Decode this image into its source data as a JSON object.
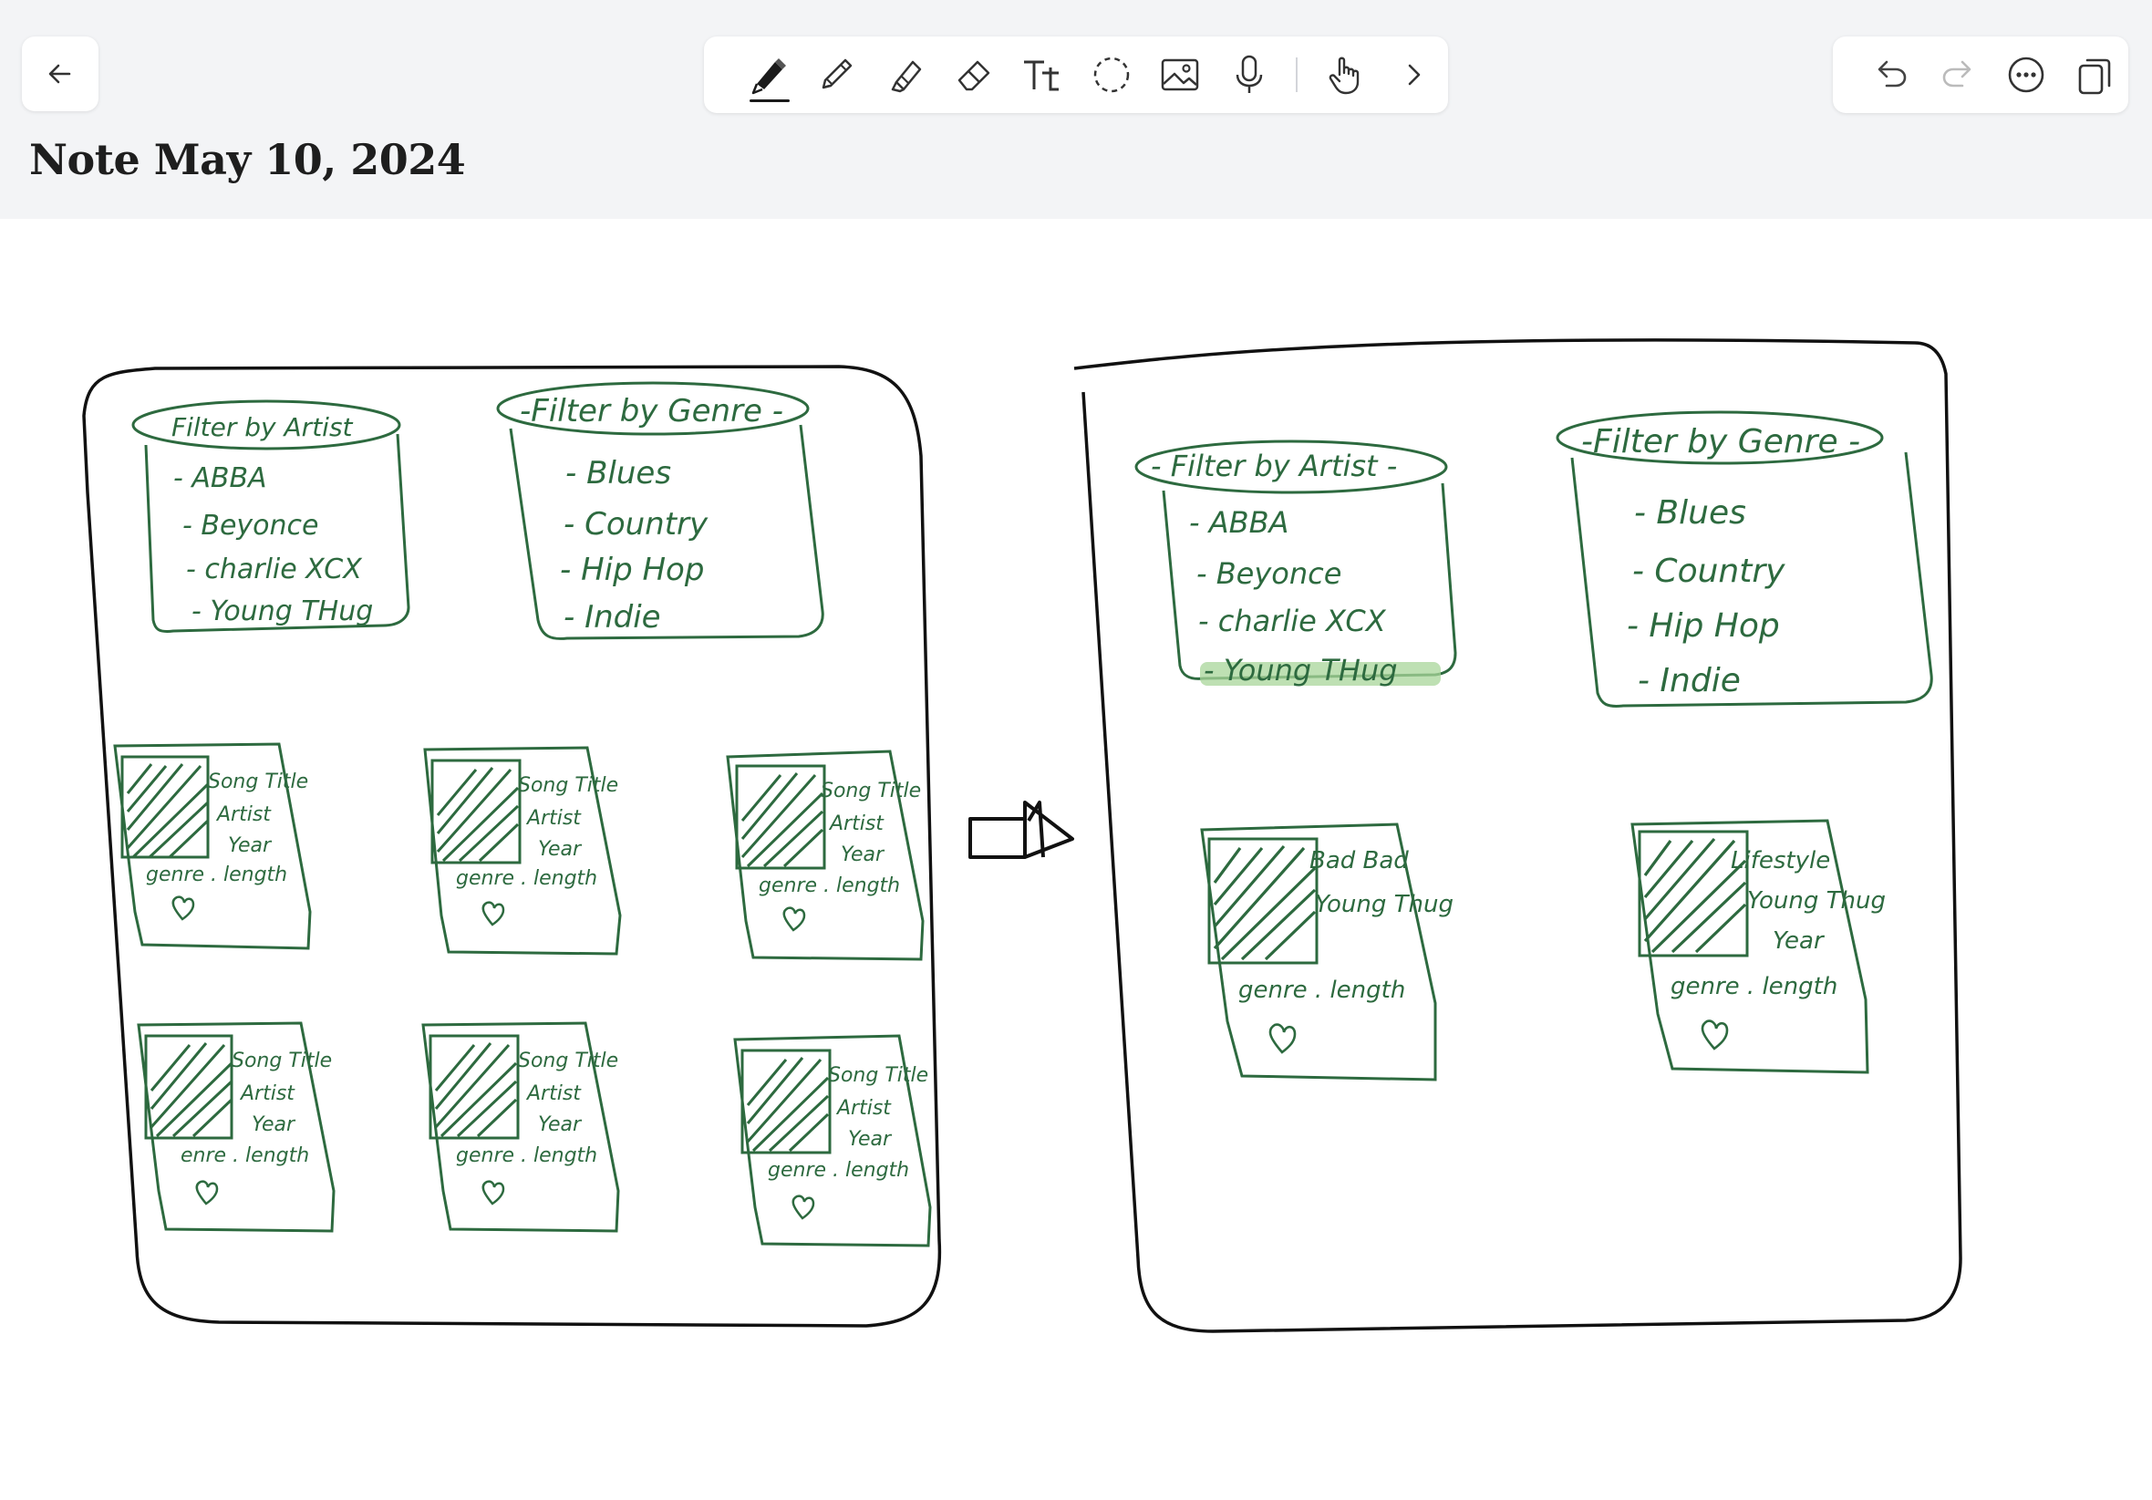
{
  "app": {
    "note_title": "Note May 10, 2024"
  },
  "toolbar": {
    "tools": [
      {
        "name": "pen-tool",
        "icon": "fountain-pen-icon",
        "active": true
      },
      {
        "name": "pencil-tool",
        "icon": "pencil-icon"
      },
      {
        "name": "highlighter-tool",
        "icon": "highlighter-icon"
      },
      {
        "name": "eraser-tool",
        "icon": "eraser-icon"
      },
      {
        "name": "text-tool",
        "icon": "text-tt-icon",
        "label": "Tt"
      },
      {
        "name": "lasso-tool",
        "icon": "lasso-icon"
      },
      {
        "name": "image-tool",
        "icon": "image-icon"
      },
      {
        "name": "audio-tool",
        "icon": "microphone-icon"
      },
      {
        "name": "touch-tool",
        "icon": "hand-pointer-icon"
      },
      {
        "name": "more-tools",
        "icon": "chevron-right-icon"
      }
    ]
  },
  "actions": [
    {
      "name": "undo-button",
      "icon": "undo-icon"
    },
    {
      "name": "redo-button",
      "icon": "redo-icon",
      "disabled": true
    },
    {
      "name": "more-button",
      "icon": "ellipsis-icon"
    },
    {
      "name": "pages-button",
      "icon": "pages-icon"
    }
  ],
  "ink": {
    "black": "#111111",
    "green": "#2d6a3f",
    "highlight": "#a8d69a"
  },
  "sketch": {
    "left_frame": {
      "artist_filter": {
        "title": "Filter by Artist",
        "items": [
          "- ABBA",
          "- Beyonce",
          "- charlie XCX",
          "- Young THug"
        ]
      },
      "genre_filter": {
        "title": "-Filter by Genre -",
        "items": [
          "- Blues",
          "- Country",
          "- Hip Hop",
          "- Indie"
        ]
      },
      "cards": [
        {
          "lines": [
            "Song Title",
            "Artist",
            "Year"
          ],
          "meta": "genre . length"
        },
        {
          "lines": [
            "Song Title",
            "Artist",
            "Year"
          ],
          "meta": "genre . length"
        },
        {
          "lines": [
            "Song Title",
            "Artist",
            "Year"
          ],
          "meta": "genre . length"
        },
        {
          "lines": [
            "Song Title",
            "Artist",
            "Year"
          ],
          "meta": "enre . length"
        },
        {
          "lines": [
            "Song Title",
            "Artist",
            "Year"
          ],
          "meta": "genre . length"
        },
        {
          "lines": [
            "Song Title",
            "Artist",
            "Year"
          ],
          "meta": "genre . length"
        }
      ]
    },
    "right_frame": {
      "artist_filter": {
        "title": "- Filter by Artist -",
        "items": [
          "- ABBA",
          "- Beyonce",
          "- charlie XCX",
          "- Young THug"
        ],
        "highlighted_index": 3
      },
      "genre_filter": {
        "title": "-Filter by Genre -",
        "items": [
          "- Blues",
          "- Country",
          "- Hip Hop",
          "- Indie"
        ]
      },
      "cards": [
        {
          "lines": [
            "Bad Bad",
            "Young Thug"
          ],
          "meta": "genre . length"
        },
        {
          "lines": [
            "Lifestyle",
            "Young Thug",
            "Year"
          ],
          "meta": "genre . length"
        }
      ]
    }
  }
}
